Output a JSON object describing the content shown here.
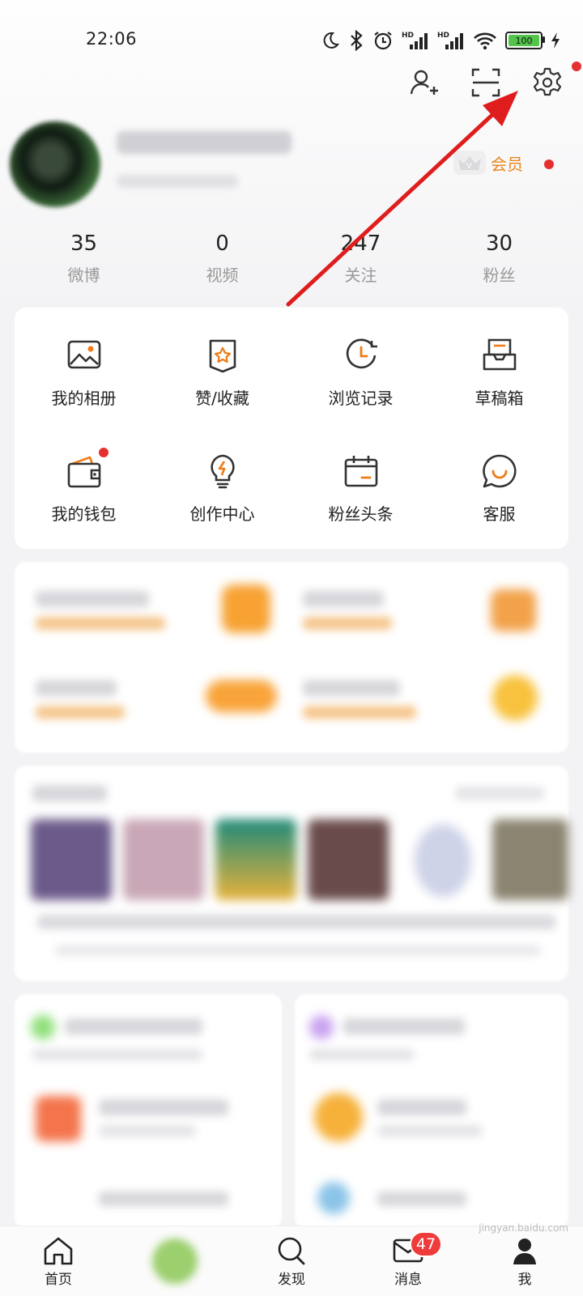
{
  "status_bar": {
    "time": "22:06",
    "battery": "100",
    "icons": [
      "moon-icon",
      "bluetooth-icon",
      "alarm-icon",
      "signal-hd-icon",
      "signal-hd-icon",
      "wifi-icon",
      "battery-icon",
      "charging-icon"
    ]
  },
  "header": {
    "actions": [
      "add-friend-icon",
      "scan-icon",
      "settings-icon"
    ],
    "vip_label": "会员"
  },
  "stats": [
    {
      "num": "35",
      "label": "微博"
    },
    {
      "num": "0",
      "label": "视频"
    },
    {
      "num": "247",
      "label": "关注"
    },
    {
      "num": "30",
      "label": "粉丝"
    }
  ],
  "tools": [
    {
      "label": "我的相册",
      "icon": "photo-album-icon"
    },
    {
      "label": "赞/收藏",
      "icon": "favorite-bookmark-icon"
    },
    {
      "label": "浏览记录",
      "icon": "history-clock-icon"
    },
    {
      "label": "草稿箱",
      "icon": "drafts-tray-icon"
    },
    {
      "label": "我的钱包",
      "icon": "wallet-icon"
    },
    {
      "label": "创作中心",
      "icon": "lightbulb-icon"
    },
    {
      "label": "粉丝头条",
      "icon": "calendar-icon"
    },
    {
      "label": "客服",
      "icon": "chat-bubble-icon"
    }
  ],
  "tabbar": [
    {
      "label": "首页",
      "icon": "home-icon"
    },
    {
      "label": "",
      "icon": "center-blob"
    },
    {
      "label": "发现",
      "icon": "search-icon"
    },
    {
      "label": "消息",
      "icon": "mail-icon",
      "badge": "47"
    },
    {
      "label": "我",
      "icon": "profile-icon"
    }
  ],
  "colors": {
    "accent": "#e8871e",
    "badge": "#ee3b3b",
    "arrow": "#e01d1d"
  },
  "watermark": "jingyan.baidu.com"
}
